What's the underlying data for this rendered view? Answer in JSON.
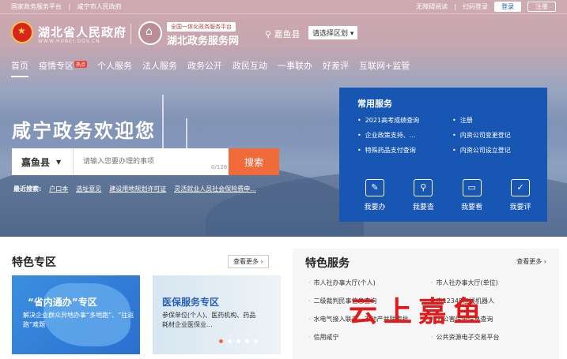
{
  "topbar": {
    "left_links": [
      "国家政务服务平台",
      "咸宁市人民政府"
    ],
    "right_links": [
      "无障碍阅读",
      "扫码登录"
    ],
    "login": "登录",
    "register": "注册"
  },
  "header": {
    "gov_title": "湖北省人民政府",
    "gov_subtitle": "WWW.HUBEI.GOV.CN",
    "service_badge": "全国一体化政务服务平台",
    "service_title": "湖北政务服务网",
    "location": "嘉鱼县",
    "region_select": "请选择区划 ▾"
  },
  "nav": {
    "items": [
      "首页",
      "疫情专区",
      "个人服务",
      "法人服务",
      "政务公开",
      "政民互动",
      "一事联办",
      "好差评",
      "互联网+监管"
    ],
    "badge": "热点"
  },
  "hero": {
    "welcome": "咸宁政务欢迎您",
    "search_county": "嘉鱼县",
    "search_placeholder": "请输入您要办理的事项",
    "search_count": "0/128",
    "search_button": "搜索",
    "recent_label": "最近搜索:",
    "recent_items": [
      "户口本",
      "选址意见",
      "建设用地规划许可证",
      "灵活就业人员社会保险费申..."
    ]
  },
  "common_services": {
    "title": "常用服务",
    "links": [
      "2021高考成绩查询",
      "注册",
      "企业政策支持、...",
      "内资公司变更登记",
      "特殊药品支付查询",
      "内资公司设立登记"
    ],
    "actions": [
      {
        "label": "我要办",
        "icon": "doc-edit-icon"
      },
      {
        "label": "我要查",
        "icon": "person-search-icon"
      },
      {
        "label": "我要看",
        "icon": "screen-icon"
      },
      {
        "label": "我要评",
        "icon": "chat-icon"
      }
    ]
  },
  "featured_zone": {
    "title": "特色专区",
    "more": "查看更多 ›",
    "card1_title": "“省内通办”专区",
    "card1_desc": "解决企业群众异地办事“多地跑”、“往返跑”难题",
    "card2_title": "医保服务专区",
    "card2_desc": "参保单位(个人)、医药机构、药品耗材企业医保业..."
  },
  "featured_services": {
    "title": "特色服务",
    "more": "查看更多 ›",
    "items": [
      "市人社办事大厅(个人)",
      "市人社办事大厅(单位)",
      "二级裁判民事信息查询",
      "市12345在线机器人",
      "水电气接入联办、不动产并联审批",
      "无公害信用信息查询",
      "信用咸宁",
      "公共资源电子交易平台"
    ]
  },
  "watermark": "云上嘉鱼",
  "colors": {
    "primary_blue": "#1757b3",
    "search_orange": "#f06a3a",
    "watermark_red": "#e01a1a"
  }
}
